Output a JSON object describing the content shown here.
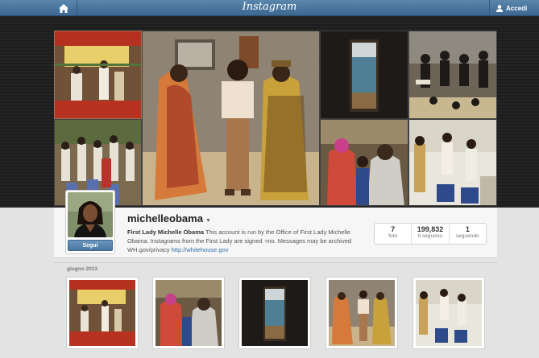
{
  "header": {
    "logo": "Instagram",
    "login_label": "Accedi",
    "icons": {
      "home": "home-icon",
      "user": "user-icon"
    }
  },
  "banner": {
    "tiles": [
      {
        "name": "banner-photo-bienvenue-event",
        "alt": "Bienvenue Mme Obama"
      },
      {
        "name": "banner-photo-schoolchildren"
      },
      {
        "name": "banner-photo-featured-women"
      },
      {
        "name": "banner-photo-door-ocean"
      },
      {
        "name": "banner-photo-dancers"
      },
      {
        "name": "banner-photo-crowd"
      },
      {
        "name": "banner-photo-classroom"
      }
    ]
  },
  "profile": {
    "username": "michelleobama",
    "follow_label": "Segui",
    "bio_name": "First Lady Michelle Obama",
    "bio_text": " This account is run by the Office of First Lady Michelle Obama. Instagrams from the First Lady are signed -mo. Messages may be archived WH.gov/privacy ",
    "bio_link": "http://whitehouse.gov",
    "stats": [
      {
        "value": "7",
        "label": "foto"
      },
      {
        "value": "199,832",
        "label": "ti seguono"
      },
      {
        "value": "1",
        "label": "seguendo"
      }
    ]
  },
  "feed": {
    "date_label": "giugno 2013",
    "photos": [
      {
        "name": "photo-bienvenue"
      },
      {
        "name": "photo-crowd"
      },
      {
        "name": "photo-door"
      },
      {
        "name": "photo-women"
      },
      {
        "name": "photo-classroom"
      }
    ]
  },
  "colors": {
    "topbar": "#3f6b94",
    "link": "#2f6fa7",
    "banner_bg": "#222222"
  }
}
